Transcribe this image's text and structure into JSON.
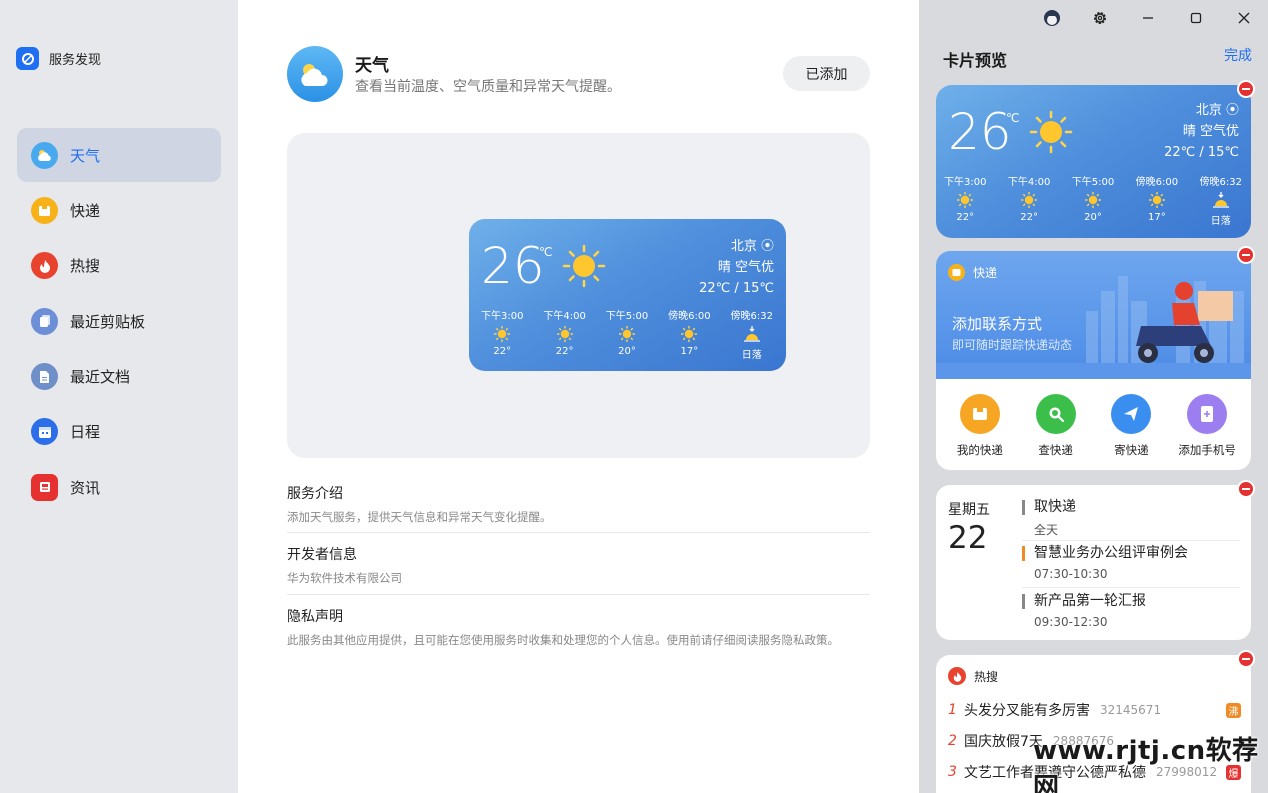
{
  "app": {
    "title": "服务发现",
    "accent": "#1f6ff2"
  },
  "sidebar": {
    "items": [
      {
        "label": "天气",
        "icon": "weather-icon",
        "active": true
      },
      {
        "label": "快递",
        "icon": "express-icon"
      },
      {
        "label": "热搜",
        "icon": "hot-search-icon"
      },
      {
        "label": "最近剪贴板",
        "icon": "clipboard-icon"
      },
      {
        "label": "最近文档",
        "icon": "document-icon"
      },
      {
        "label": "日程",
        "icon": "calendar-icon"
      },
      {
        "label": "资讯",
        "icon": "news-icon"
      }
    ]
  },
  "service": {
    "name": "天气",
    "desc": "查看当前温度、空气质量和异常天气提醒。",
    "button": "已添加"
  },
  "weather": {
    "temp": "26",
    "unit": "℃",
    "city": "北京",
    "condition": "晴  空气优",
    "range": "22℃ / 15℃",
    "hours": [
      {
        "time": "下午3:00",
        "value": "22°",
        "icon": "sun-icon"
      },
      {
        "time": "下午4:00",
        "value": "22°",
        "icon": "sun-icon"
      },
      {
        "time": "下午5:00",
        "value": "20°",
        "icon": "sun-icon"
      },
      {
        "time": "傍晚6:00",
        "value": "17°",
        "icon": "sun-icon"
      },
      {
        "time": "傍晚6:32",
        "value": "日落",
        "icon": "sunset-icon"
      }
    ]
  },
  "info": [
    {
      "title": "服务介绍",
      "text": "添加天气服务，提供天气信息和异常天气变化提醒。"
    },
    {
      "title": "开发者信息",
      "text": "华为软件技术有限公司"
    },
    {
      "title": "隐私声明",
      "text": "此服务由其他应用提供，且可能在您使用服务时收集和处理您的个人信息。使用前请仔细阅读服务隐私政策。"
    }
  ],
  "panel": {
    "title": "卡片预览",
    "done": "完成",
    "express": {
      "tag": "快递",
      "headline": "添加联系方式",
      "sub": "即可随时跟踪快递动态",
      "actions": [
        {
          "label": "我的快递",
          "color": "#f6a623",
          "icon": "package-icon"
        },
        {
          "label": "查快递",
          "color": "#3cbf4a",
          "icon": "search-icon"
        },
        {
          "label": "寄快递",
          "color": "#3a8ef0",
          "icon": "send-icon"
        },
        {
          "label": "添加手机号",
          "color": "#9d7ef0",
          "icon": "add-phone-icon"
        }
      ]
    },
    "schedule": {
      "weekday": "星期五",
      "day": "22",
      "events": [
        {
          "title": "取快递",
          "time": "全天",
          "color": "#777777"
        },
        {
          "title": "智慧业务办公组评审例会",
          "time": "07:30-10:30",
          "color": "#f08a24"
        },
        {
          "title": "新产品第一轮汇报",
          "time": "09:30-12:30",
          "color": "#777777"
        }
      ]
    },
    "hot": {
      "tag": "热搜",
      "rows": [
        {
          "rank": "1",
          "title": "头发分叉能有多厉害",
          "count": "32145671",
          "badge": "沸",
          "badge_color": "#f08a24"
        },
        {
          "rank": "2",
          "title": "国庆放假7天",
          "count": "28887676",
          "badge": "",
          "badge_color": ""
        },
        {
          "rank": "3",
          "title": "文艺工作者要遵守公德严私德",
          "count": "27998012",
          "badge": "爆",
          "badge_color": "#e5312f"
        }
      ]
    }
  },
  "watermark": "www.rjtj.cn软荐网"
}
